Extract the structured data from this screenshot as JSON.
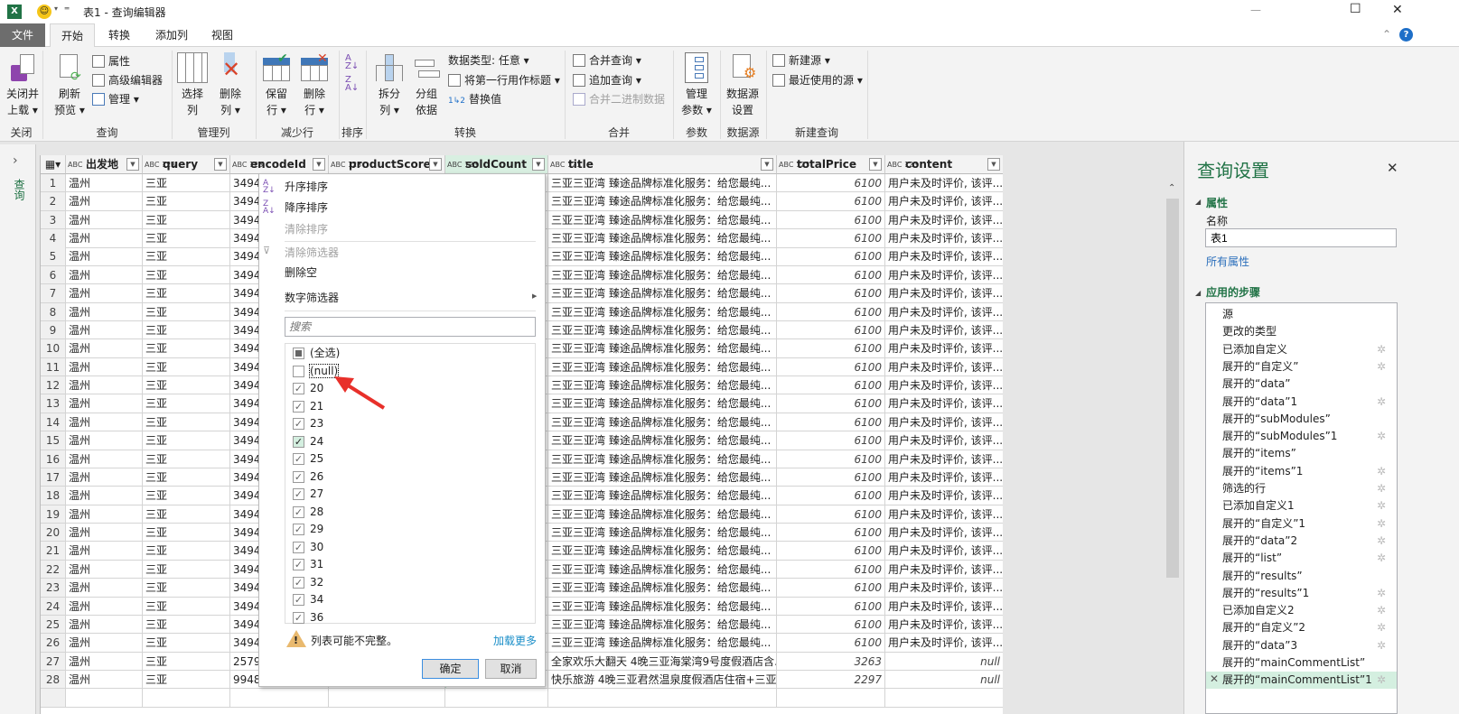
{
  "window": {
    "title": "表1 - 查询编辑器",
    "minimize": "—",
    "maximize": "☐",
    "close": "✕"
  },
  "tabs": [
    {
      "label": "文件"
    },
    {
      "label": "开始"
    },
    {
      "label": "转换"
    },
    {
      "label": "添加列"
    },
    {
      "label": "视图"
    }
  ],
  "ribbon": {
    "close_load": "关闭并",
    "close_load2": "上载",
    "refresh": "刷新",
    "refresh2": "预览",
    "properties": "属性",
    "advanced_editor": "高级编辑器",
    "manage": "管理",
    "choose_cols": "选择",
    "choose_cols2": "列",
    "remove_cols": "删除",
    "remove_cols2": "列",
    "keep_rows": "保留",
    "keep_rows2": "行",
    "remove_rows": "删除",
    "remove_rows2": "行",
    "split": "拆分",
    "split2": "列",
    "group": "分组",
    "group2": "依据",
    "data_type": "数据类型: 任意",
    "first_row_header": "将第一行用作标题",
    "replace": "替换值",
    "merge_queries": "合并查询",
    "append_queries": "追加查询",
    "combine_binaries": "合并二进制数据",
    "manage_params": "管理",
    "manage_params2": "参数",
    "ds_settings": "数据源",
    "ds_settings2": "设置",
    "new_source": "新建源",
    "recent_sources": "最近使用的源",
    "groups": {
      "close": "关闭",
      "query": "查询",
      "manage_cols": "管理列",
      "reduce_rows": "减少行",
      "sort": "排序",
      "transform": "转换",
      "combine": "合并",
      "params": "参数",
      "datasource": "数据源",
      "new_query": "新建查询"
    }
  },
  "left_pane": {
    "label": "查询"
  },
  "columns": [
    {
      "name": "出发地",
      "type": "ABC"
    },
    {
      "name": "query",
      "type": "ABC 123"
    },
    {
      "name": "encodeId",
      "type": "ABC 123"
    },
    {
      "name": "productScore",
      "type": "ABC 123"
    },
    {
      "name": "soldCount",
      "type": "ABC 123"
    },
    {
      "name": "title",
      "type": "ABC 123"
    },
    {
      "name": "totalPrice",
      "type": "ABC 123"
    },
    {
      "name": "content",
      "type": "ABC 123"
    }
  ],
  "rows": [
    [
      "1",
      "温州",
      "三亚",
      "34942",
      "三亚三亚湾 臻途品牌标准化服务：给您最纯...",
      "6100",
      "用户未及时评价, 该评..."
    ],
    [
      "2",
      "温州",
      "三亚",
      "34942",
      "三亚三亚湾 臻途品牌标准化服务：给您最纯...",
      "6100",
      "用户未及时评价, 该评..."
    ],
    [
      "3",
      "温州",
      "三亚",
      "34942",
      "三亚三亚湾 臻途品牌标准化服务：给您最纯...",
      "6100",
      "用户未及时评价, 该评..."
    ],
    [
      "4",
      "温州",
      "三亚",
      "34942",
      "三亚三亚湾 臻途品牌标准化服务：给您最纯...",
      "6100",
      "用户未及时评价, 该评..."
    ],
    [
      "5",
      "温州",
      "三亚",
      "34942",
      "三亚三亚湾 臻途品牌标准化服务：给您最纯...",
      "6100",
      "用户未及时评价, 该评..."
    ],
    [
      "6",
      "温州",
      "三亚",
      "34942",
      "三亚三亚湾 臻途品牌标准化服务：给您最纯...",
      "6100",
      "用户未及时评价, 该评..."
    ],
    [
      "7",
      "温州",
      "三亚",
      "34942",
      "三亚三亚湾 臻途品牌标准化服务：给您最纯...",
      "6100",
      "用户未及时评价, 该评..."
    ],
    [
      "8",
      "温州",
      "三亚",
      "34942",
      "三亚三亚湾 臻途品牌标准化服务：给您最纯...",
      "6100",
      "用户未及时评价, 该评..."
    ],
    [
      "9",
      "温州",
      "三亚",
      "34942",
      "三亚三亚湾 臻途品牌标准化服务：给您最纯...",
      "6100",
      "用户未及时评价, 该评..."
    ],
    [
      "10",
      "温州",
      "三亚",
      "34942",
      "三亚三亚湾 臻途品牌标准化服务：给您最纯...",
      "6100",
      "用户未及时评价, 该评..."
    ],
    [
      "11",
      "温州",
      "三亚",
      "34942",
      "三亚三亚湾 臻途品牌标准化服务：给您最纯...",
      "6100",
      "用户未及时评价, 该评..."
    ],
    [
      "12",
      "温州",
      "三亚",
      "34942",
      "三亚三亚湾 臻途品牌标准化服务：给您最纯...",
      "6100",
      "用户未及时评价, 该评..."
    ],
    [
      "13",
      "温州",
      "三亚",
      "34942",
      "三亚三亚湾 臻途品牌标准化服务：给您最纯...",
      "6100",
      "用户未及时评价, 该评..."
    ],
    [
      "14",
      "温州",
      "三亚",
      "34942",
      "三亚三亚湾 臻途品牌标准化服务：给您最纯...",
      "6100",
      "用户未及时评价, 该评..."
    ],
    [
      "15",
      "温州",
      "三亚",
      "34942",
      "三亚三亚湾 臻途品牌标准化服务：给您最纯...",
      "6100",
      "用户未及时评价, 该评..."
    ],
    [
      "16",
      "温州",
      "三亚",
      "34942",
      "三亚三亚湾 臻途品牌标准化服务：给您最纯...",
      "6100",
      "用户未及时评价, 该评..."
    ],
    [
      "17",
      "温州",
      "三亚",
      "34942",
      "三亚三亚湾 臻途品牌标准化服务：给您最纯...",
      "6100",
      "用户未及时评价, 该评..."
    ],
    [
      "18",
      "温州",
      "三亚",
      "34942",
      "三亚三亚湾 臻途品牌标准化服务：给您最纯...",
      "6100",
      "用户未及时评价, 该评..."
    ],
    [
      "19",
      "温州",
      "三亚",
      "34942",
      "三亚三亚湾 臻途品牌标准化服务：给您最纯...",
      "6100",
      "用户未及时评价, 该评..."
    ],
    [
      "20",
      "温州",
      "三亚",
      "34942",
      "三亚三亚湾 臻途品牌标准化服务：给您最纯...",
      "6100",
      "用户未及时评价, 该评..."
    ],
    [
      "21",
      "温州",
      "三亚",
      "34942",
      "三亚三亚湾 臻途品牌标准化服务：给您最纯...",
      "6100",
      "用户未及时评价, 该评..."
    ],
    [
      "22",
      "温州",
      "三亚",
      "34942",
      "三亚三亚湾 臻途品牌标准化服务：给您最纯...",
      "6100",
      "用户未及时评价, 该评..."
    ],
    [
      "23",
      "温州",
      "三亚",
      "34942",
      "三亚三亚湾 臻途品牌标准化服务：给您最纯...",
      "6100",
      "用户未及时评价, 该评..."
    ],
    [
      "24",
      "温州",
      "三亚",
      "34942",
      "三亚三亚湾 臻途品牌标准化服务：给您最纯...",
      "6100",
      "用户未及时评价, 该评..."
    ],
    [
      "25",
      "温州",
      "三亚",
      "34942",
      "三亚三亚湾 臻途品牌标准化服务：给您最纯...",
      "6100",
      "用户未及时评价, 该评..."
    ],
    [
      "26",
      "温州",
      "三亚",
      "34942",
      "三亚三亚湾 臻途品牌标准化服务：给您最纯...",
      "6100",
      "用户未及时评价, 该评..."
    ],
    [
      "27",
      "温州",
      "三亚",
      "25792",
      "全家欢乐大翻天 4晚三亚海棠湾9号度假酒店含...",
      "3263",
      "null"
    ],
    [
      "28",
      "温州",
      "三亚",
      "99485",
      "快乐旅游 4晚三亚君然温泉度假酒店住宿+三亚...",
      "2297",
      "null"
    ]
  ],
  "filter_menu": {
    "sort_asc": "升序排序",
    "sort_desc": "降序排序",
    "clear_sort": "清除排序",
    "clear_filter": "清除筛选器",
    "remove_empty": "删除空",
    "number_filters": "数字筛选器",
    "search_placeholder": "搜索",
    "values": [
      {
        "label": "(全选)",
        "state": "partial"
      },
      {
        "label": "(null)",
        "state": "unchecked"
      },
      {
        "label": "20",
        "state": "checked"
      },
      {
        "label": "21",
        "state": "checked"
      },
      {
        "label": "23",
        "state": "checked"
      },
      {
        "label": "24",
        "state": "checked"
      },
      {
        "label": "25",
        "state": "checked"
      },
      {
        "label": "26",
        "state": "checked"
      },
      {
        "label": "27",
        "state": "checked"
      },
      {
        "label": "28",
        "state": "checked"
      },
      {
        "label": "29",
        "state": "checked"
      },
      {
        "label": "30",
        "state": "checked"
      },
      {
        "label": "31",
        "state": "checked"
      },
      {
        "label": "32",
        "state": "checked"
      },
      {
        "label": "34",
        "state": "checked"
      },
      {
        "label": "36",
        "state": "checked"
      }
    ],
    "warning": "列表可能不完整。",
    "load_more": "加载更多",
    "ok": "确定",
    "cancel": "取消"
  },
  "query_settings": {
    "title": "查询设置",
    "properties": "属性",
    "name_label": "名称",
    "name_value": "表1",
    "all_properties": "所有属性",
    "applied_steps": "应用的步骤",
    "steps": [
      {
        "label": "源",
        "gear": false
      },
      {
        "label": "更改的类型",
        "gear": false
      },
      {
        "label": "已添加自定义",
        "gear": true
      },
      {
        "label": "展开的“自定义”",
        "gear": true
      },
      {
        "label": "展开的“data”",
        "gear": false
      },
      {
        "label": "展开的“data”1",
        "gear": true
      },
      {
        "label": "展开的“subModules”",
        "gear": false
      },
      {
        "label": "展开的“subModules”1",
        "gear": true
      },
      {
        "label": "展开的“items”",
        "gear": false
      },
      {
        "label": "展开的“items”1",
        "gear": true
      },
      {
        "label": "筛选的行",
        "gear": true
      },
      {
        "label": "已添加自定义1",
        "gear": true
      },
      {
        "label": "展开的“自定义”1",
        "gear": true
      },
      {
        "label": "展开的“data”2",
        "gear": true
      },
      {
        "label": "展开的“list”",
        "gear": true
      },
      {
        "label": "展开的“results”",
        "gear": false
      },
      {
        "label": "展开的“results”1",
        "gear": true
      },
      {
        "label": "已添加自定义2",
        "gear": true
      },
      {
        "label": "展开的“自定义”2",
        "gear": true
      },
      {
        "label": "展开的“data”3",
        "gear": true
      },
      {
        "label": "展开的“mainCommentList”",
        "gear": false
      },
      {
        "label": "展开的“mainCommentList”1",
        "gear": true,
        "selected": true
      }
    ]
  },
  "colors": {
    "accent": "#217346",
    "selected": "#d4efe0",
    "file_tab": "#6d6d6d",
    "arrow": "#e8302a"
  }
}
